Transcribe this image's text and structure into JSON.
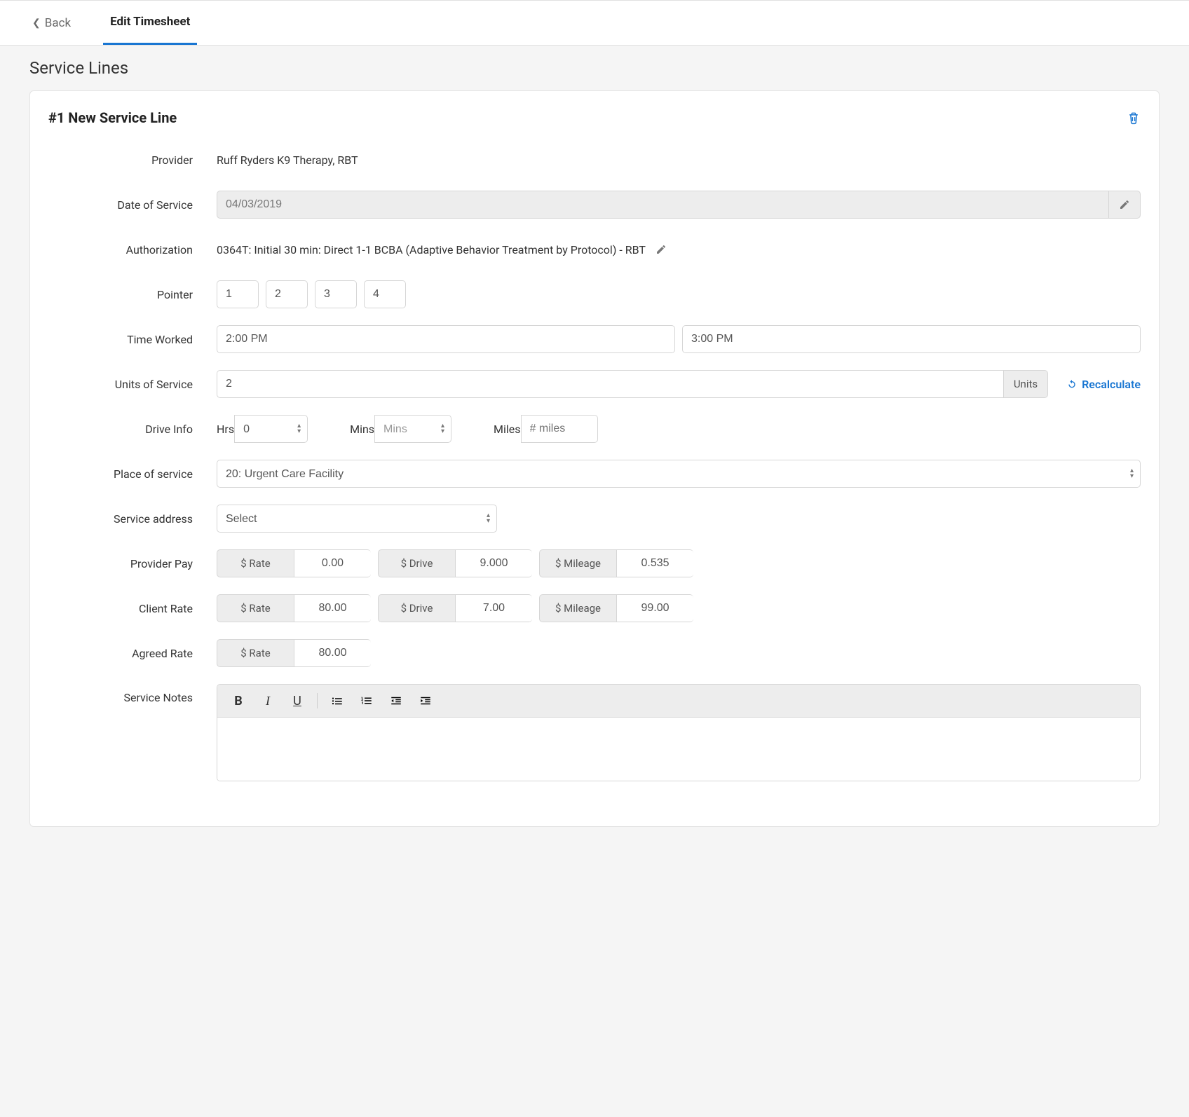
{
  "header": {
    "back_label": "Back",
    "tab_label": "Edit Timesheet"
  },
  "page": {
    "title": "Service Lines"
  },
  "serviceLine": {
    "cardTitle": "#1 New Service Line",
    "labels": {
      "provider": "Provider",
      "dateOfService": "Date of Service",
      "authorization": "Authorization",
      "pointer": "Pointer",
      "timeWorked": "Time Worked",
      "unitsOfService": "Units of Service",
      "driveInfo": "Drive Info",
      "placeOfService": "Place of service",
      "serviceAddress": "Service address",
      "providerPay": "Provider Pay",
      "clientRate": "Client Rate",
      "agreedRate": "Agreed Rate",
      "serviceNotes": "Service Notes"
    },
    "provider": "Ruff Ryders K9 Therapy, RBT",
    "dateOfService": "04/03/2019",
    "authorization": "0364T: Initial 30 min: Direct 1-1 BCBA (Adaptive Behavior Treatment by Protocol) - RBT",
    "pointer": [
      "1",
      "2",
      "3",
      "4"
    ],
    "timeWorked": {
      "start": "2:00 PM",
      "end": "3:00 PM"
    },
    "units": {
      "value": "2",
      "suffix": "Units",
      "recalculate_label": "Recalculate"
    },
    "drive": {
      "hrs_label": "Hrs",
      "hrs_value": "0",
      "mins_label": "Mins",
      "mins_placeholder": "Mins",
      "miles_label": "Miles",
      "miles_placeholder": "# miles"
    },
    "placeOfService": "20: Urgent Care Facility",
    "serviceAddress": "Select",
    "providerPay": {
      "rate_label": "$ Rate",
      "rate_value": "0.00",
      "drive_label": "$ Drive",
      "drive_value": "9.000",
      "mileage_label": "$ Mileage",
      "mileage_value": "0.535"
    },
    "clientRate": {
      "rate_label": "$ Rate",
      "rate_value": "80.00",
      "drive_label": "$ Drive",
      "drive_value": "7.00",
      "mileage_label": "$ Mileage",
      "mileage_value": "99.00"
    },
    "agreedRate": {
      "rate_label": "$ Rate",
      "rate_value": "80.00"
    }
  }
}
